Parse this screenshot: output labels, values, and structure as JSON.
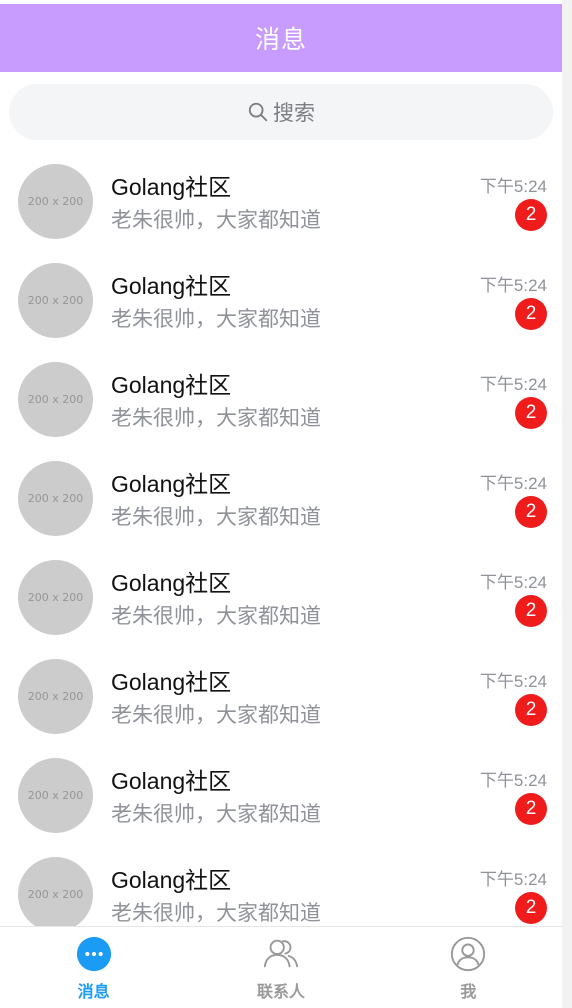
{
  "header": {
    "title": "消息"
  },
  "search": {
    "label": "搜索"
  },
  "conversations": [
    {
      "avatar_text": "200 x 200",
      "title": "Golang社区",
      "preview": "老朱很帅，大家都知道",
      "time": "下午5:24",
      "badge": "2"
    },
    {
      "avatar_text": "200 x 200",
      "title": "Golang社区",
      "preview": "老朱很帅，大家都知道",
      "time": "下午5:24",
      "badge": "2"
    },
    {
      "avatar_text": "200 x 200",
      "title": "Golang社区",
      "preview": "老朱很帅，大家都知道",
      "time": "下午5:24",
      "badge": "2"
    },
    {
      "avatar_text": "200 x 200",
      "title": "Golang社区",
      "preview": "老朱很帅，大家都知道",
      "time": "下午5:24",
      "badge": "2"
    },
    {
      "avatar_text": "200 x 200",
      "title": "Golang社区",
      "preview": "老朱很帅，大家都知道",
      "time": "下午5:24",
      "badge": "2"
    },
    {
      "avatar_text": "200 x 200",
      "title": "Golang社区",
      "preview": "老朱很帅，大家都知道",
      "time": "下午5:24",
      "badge": "2"
    },
    {
      "avatar_text": "200 x 200",
      "title": "Golang社区",
      "preview": "老朱很帅，大家都知道",
      "time": "下午5:24",
      "badge": "2"
    },
    {
      "avatar_text": "200 x 200",
      "title": "Golang社区",
      "preview": "老朱很帅，大家都知道",
      "time": "下午5:24",
      "badge": "2"
    }
  ],
  "tabbar": {
    "active_color": "#1a9bf4",
    "inactive_color": "#999999",
    "tabs": [
      {
        "label": "消息",
        "icon": "chat-bubble-icon",
        "active": true
      },
      {
        "label": "联系人",
        "icon": "contacts-icon",
        "active": false
      },
      {
        "label": "我",
        "icon": "profile-icon",
        "active": false
      }
    ]
  },
  "colors": {
    "header": "#c89cff",
    "badge": "#f01c1c"
  }
}
